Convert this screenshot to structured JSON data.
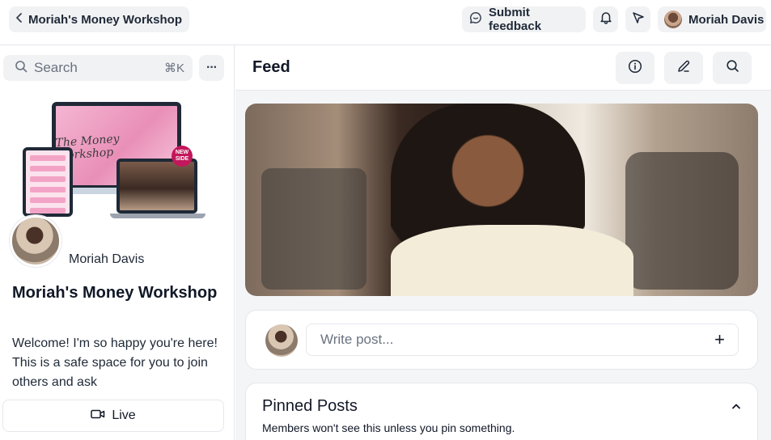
{
  "topbar": {
    "back_label": "Moriah's Money Workshop",
    "feedback_label": "Submit feedback",
    "user_name": "Moriah Davis"
  },
  "sidebar": {
    "search_placeholder": "Search",
    "search_shortcut": "⌘K",
    "more_label": "···",
    "cover": {
      "laptop_title": "The Money Workshop",
      "badge": "NEW SIDE"
    },
    "owner_name": "Moriah Davis",
    "group_title": "Moriah's Money Workshop",
    "group_description": "Welcome! I'm so happy you're here! This is a safe space for you to join others and ask",
    "live_label": "Live"
  },
  "main": {
    "feed_title": "Feed",
    "compose_placeholder": "Write post...",
    "compose_plus": "+",
    "pinned_title": "Pinned Posts",
    "pinned_subtitle": "Members won't see this unless you pin something."
  }
}
